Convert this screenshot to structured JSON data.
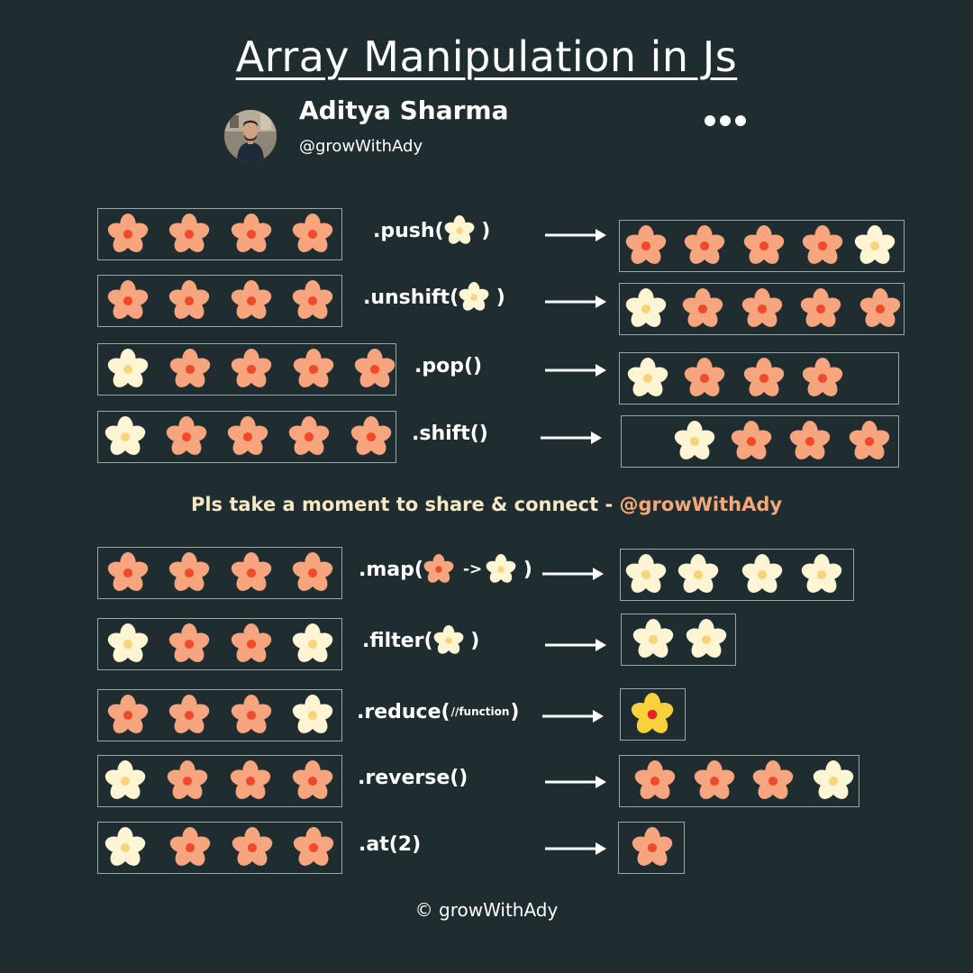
{
  "title": "Array Manipulation in Js",
  "author": {
    "name": "Aditya Sharma",
    "handle": "@growWithAdy"
  },
  "colors": {
    "background": "#1f2d31",
    "orange_petal": "#f7a57e",
    "orange_center": "#ef4a2c",
    "cream_petal": "#fdf5d3",
    "cream_center": "#f6d57a",
    "gold_petal": "#f9d13a",
    "gold_center": "#e0262a",
    "cta_text": "#f5e8c4",
    "cta_handle": "#f4a87a"
  },
  "operations_top": [
    {
      "method": ".push(",
      "arg": "cream",
      "close": " )",
      "input": [
        "orange",
        "orange",
        "orange",
        "orange"
      ],
      "output": [
        "orange",
        "orange",
        "orange",
        "orange",
        "cream"
      ]
    },
    {
      "method": ".unshift(",
      "arg": "cream",
      "close": " )",
      "input": [
        "orange",
        "orange",
        "orange",
        "orange"
      ],
      "output": [
        "cream",
        "orange",
        "orange",
        "orange",
        "orange"
      ]
    },
    {
      "method": ".pop()",
      "input": [
        "cream",
        "orange",
        "orange",
        "orange",
        "orange"
      ],
      "output": [
        "cream",
        "orange",
        "orange",
        "orange"
      ]
    },
    {
      "method": ".shift()",
      "input": [
        "cream",
        "orange",
        "orange",
        "orange",
        "orange"
      ],
      "output": [
        "cream",
        "orange",
        "orange",
        "orange"
      ]
    }
  ],
  "cta": {
    "text": "Pls take a moment to share & connect - ",
    "handle": "@growWithAdy"
  },
  "operations_bottom": [
    {
      "method": ".map(",
      "arg_from": "orange",
      "arrow": "->",
      "arg_to": "cream",
      "close": " )",
      "input": [
        "orange",
        "orange",
        "orange",
        "orange"
      ],
      "output": [
        "cream",
        "cream",
        "cream",
        "cream"
      ]
    },
    {
      "method": ".filter(",
      "arg": "cream",
      "close": " )",
      "input": [
        "cream",
        "orange",
        "orange",
        "cream"
      ],
      "output": [
        "cream",
        "cream"
      ]
    },
    {
      "method": ".reduce(",
      "arg_text": "//function",
      "close": ")",
      "input": [
        "orange",
        "orange",
        "orange",
        "cream"
      ],
      "output": [
        "gold"
      ]
    },
    {
      "method": ".reverse()",
      "input": [
        "cream",
        "orange",
        "orange",
        "orange"
      ],
      "output": [
        "orange",
        "orange",
        "orange",
        "cream"
      ]
    },
    {
      "method": ".at(2)",
      "input": [
        "cream",
        "orange",
        "orange",
        "orange"
      ],
      "output": [
        "orange"
      ]
    }
  ],
  "footer": "© growWithAdy"
}
